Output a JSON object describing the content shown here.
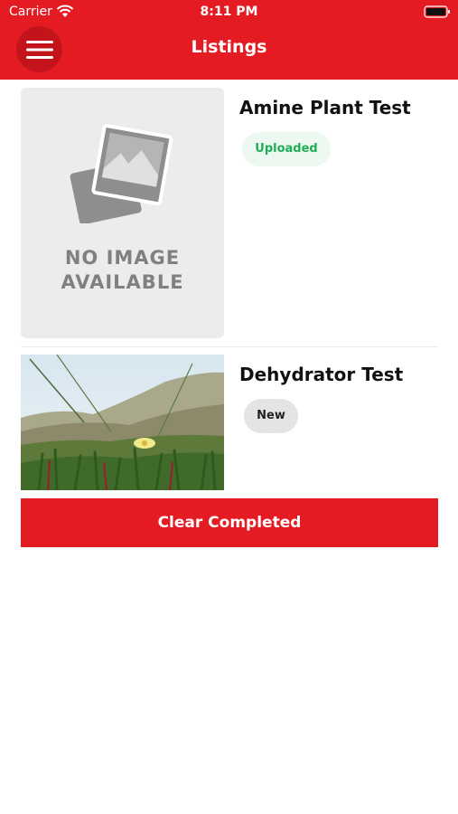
{
  "status_bar": {
    "carrier": "Carrier",
    "time": "8:11 PM"
  },
  "header": {
    "title": "Listings",
    "menu_icon": "hamburger-menu-icon"
  },
  "listings": [
    {
      "title": "Amine Plant Test",
      "status": "Uploaded",
      "image_text": "NO IMAGE\nAVAILABLE"
    },
    {
      "title": "Dehydrator Test",
      "status": "New"
    }
  ],
  "actions": {
    "clear_completed": "Clear Completed"
  },
  "colors": {
    "accent": "#e51b23",
    "uploaded_text": "#1fae55",
    "uploaded_bg": "#ecf8f0",
    "new_bg": "#e4e4e4"
  }
}
